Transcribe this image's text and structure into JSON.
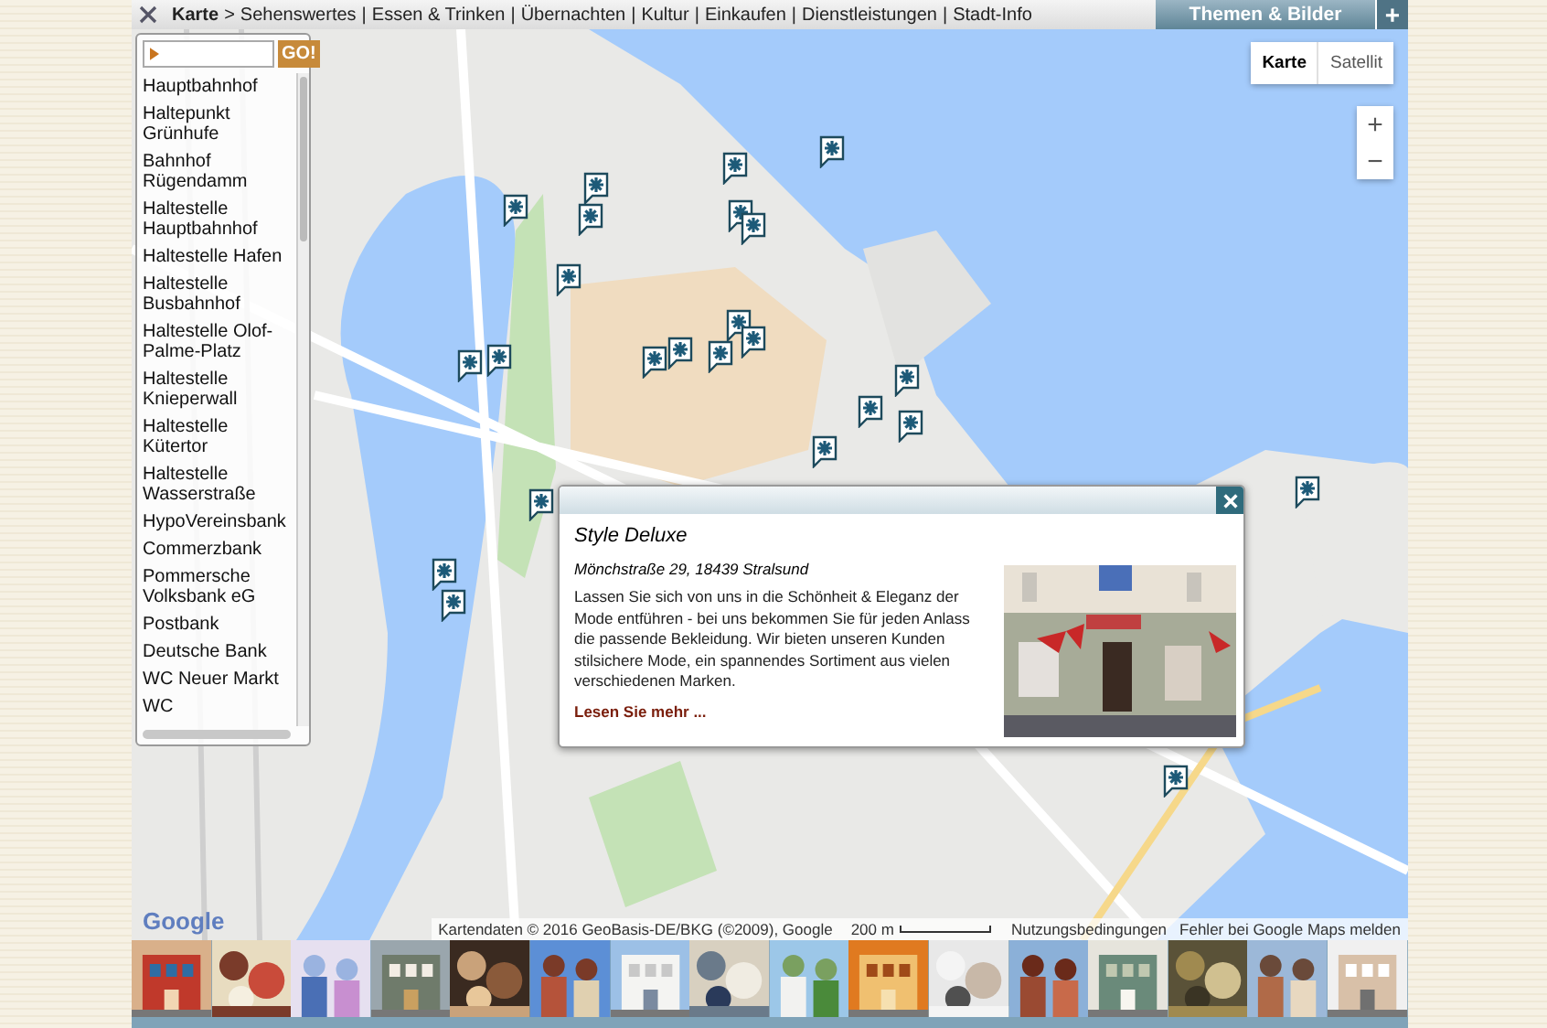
{
  "nav": {
    "home": "Karte",
    "separator": ">",
    "divider": "|",
    "items": [
      "Sehenswertes",
      "Essen & Trinken",
      "Übernachten",
      "Kultur",
      "Einkaufen",
      "Dienstleistungen",
      "Stadt-Info"
    ]
  },
  "panel": {
    "title": "Themen & Bilder",
    "add": "+"
  },
  "sidebar": {
    "go": "GO!",
    "items": [
      "Hauptbahnhof",
      "Haltepunkt Grünhufe",
      "Bahnhof Rügendamm",
      "Haltestelle Hauptbahnhof",
      "Haltestelle Hafen",
      "Haltestelle Busbahnhof",
      "Haltestelle Olof-Palme-Platz",
      "Haltestelle Knieperwall",
      "Haltestelle Kütertor",
      "Haltestelle Wasserstraße",
      "HypoVereinsbank",
      "Commerzbank",
      "Pommersche Volksbank eG",
      "Postbank",
      "Deutsche Bank",
      "WC Neuer Markt",
      "WC"
    ]
  },
  "map_type": [
    {
      "label": "Karte",
      "selected": true
    },
    {
      "label": "Satellit",
      "selected": false
    }
  ],
  "zoom": {
    "in": "+",
    "out": "−"
  },
  "popup": {
    "title": "Style Deluxe",
    "address": "Mönchstraße 29, 18439 Stralsund",
    "text": "Lassen Sie sich von uns in die Schönheit & Eleganz der Mode entführen - bei uns bekommen Sie für jeden Anlass die passende Bekleidung. Wir bieten unseren Kunden stilsichere Mode, ein spannendes Sortiment aus vielen verschiedenen Marken.",
    "link": "Lesen Sie mehr ..."
  },
  "attribution": {
    "logo": "Google",
    "data": "Kartendaten © 2016 GeoBasis-DE/BKG (©2009), Google",
    "scale": "200 m",
    "terms": "Nutzungsbedingungen",
    "report": "Fehler bei Google Maps melden"
  }
}
